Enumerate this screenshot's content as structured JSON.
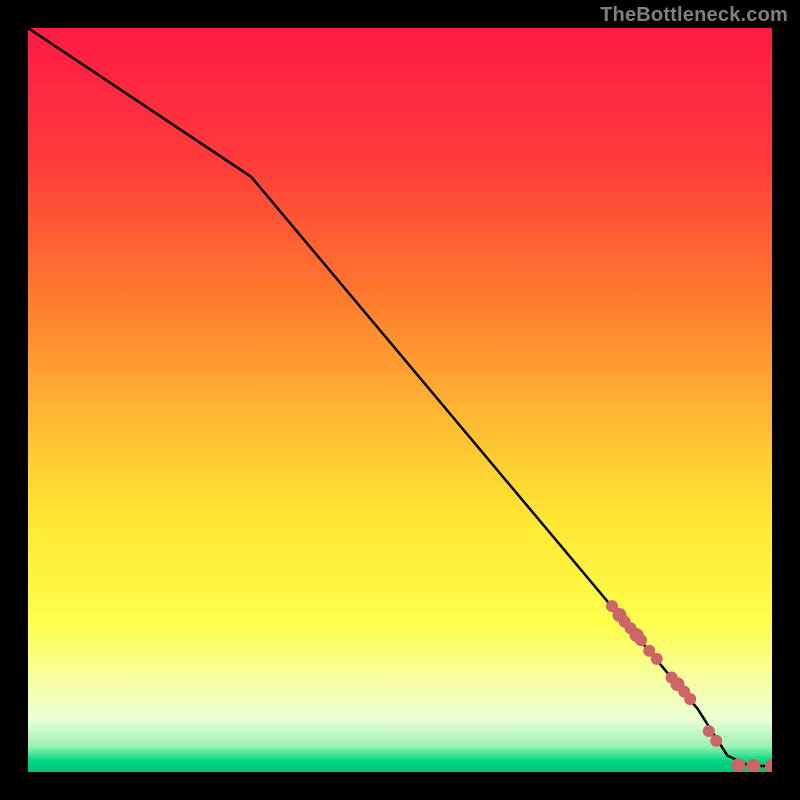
{
  "attribution": "TheBottleneck.com",
  "colors": {
    "marker": "#cc6666",
    "line": "#000000",
    "gradient": [
      {
        "offset": 0.0,
        "color": "#ff1a44"
      },
      {
        "offset": 0.18,
        "color": "#ff3b3b"
      },
      {
        "offset": 0.36,
        "color": "#ff7a2e"
      },
      {
        "offset": 0.52,
        "color": "#ffb833"
      },
      {
        "offset": 0.66,
        "color": "#ffe733"
      },
      {
        "offset": 0.8,
        "color": "#feff4a"
      },
      {
        "offset": 0.88,
        "color": "#f6ffa6"
      },
      {
        "offset": 0.93,
        "color": "#eaffd4"
      },
      {
        "offset": 0.965,
        "color": "#9cf2b4"
      },
      {
        "offset": 0.985,
        "color": "#00d884"
      },
      {
        "offset": 1.0,
        "color": "#00c474"
      }
    ]
  },
  "chart_data": {
    "type": "line",
    "title": "",
    "xlabel": "",
    "ylabel": "",
    "xlim": [
      0,
      100
    ],
    "ylim": [
      0,
      100
    ],
    "series": [
      {
        "name": "curve",
        "x": [
          0,
          30,
          90,
          94,
          97,
          100
        ],
        "y": [
          100,
          80,
          8.5,
          2.2,
          0.8,
          0.8
        ]
      }
    ],
    "markers": {
      "name": "points",
      "x": [
        78.5,
        79.5,
        80.2,
        81.0,
        81.8,
        82.4,
        83.5,
        84.5,
        86.5,
        87.3,
        88.2,
        89.0,
        91.5,
        92.5,
        95.5,
        97.5,
        100
      ],
      "y": [
        22.3,
        21.1,
        20.2,
        19.3,
        18.4,
        17.7,
        16.3,
        15.2,
        12.7,
        11.8,
        10.8,
        9.8,
        5.5,
        4.2,
        0.9,
        0.8,
        0.8
      ],
      "r": [
        6,
        7,
        6,
        6,
        7,
        6,
        6,
        6,
        6,
        7,
        6,
        6,
        6,
        6,
        7,
        7,
        7
      ]
    }
  }
}
